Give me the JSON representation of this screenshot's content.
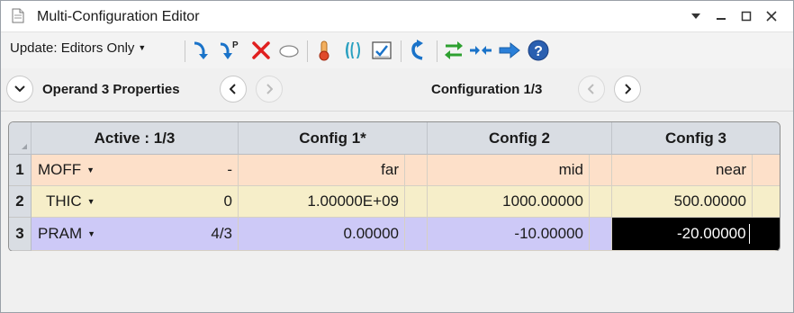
{
  "window": {
    "title": "Multi-Configuration Editor"
  },
  "toolbar": {
    "update_label": "Update: Editors Only"
  },
  "navbar": {
    "operand_label": "Operand  3 Properties",
    "config_label": "Configuration 1/3"
  },
  "grid": {
    "headers": [
      "Active : 1/3",
      "Config 1*",
      "Config 2",
      "Config 3"
    ],
    "rows": [
      {
        "num": "1",
        "operand": "MOFF",
        "param": "-",
        "values": [
          "far",
          "mid",
          "near"
        ]
      },
      {
        "num": "2",
        "operand": "THIC",
        "param": "0",
        "values": [
          "1.00000E+09",
          "1000.00000",
          "500.00000"
        ]
      },
      {
        "num": "3",
        "operand": "PRAM",
        "param": "4/3",
        "values": [
          "0.00000",
          "-10.00000",
          "-20.00000"
        ]
      }
    ]
  },
  "colors": {
    "row1": "#fde0c9",
    "row2": "#f6eec9",
    "row3": "#cdc9f7",
    "header": "#d9dde3"
  }
}
